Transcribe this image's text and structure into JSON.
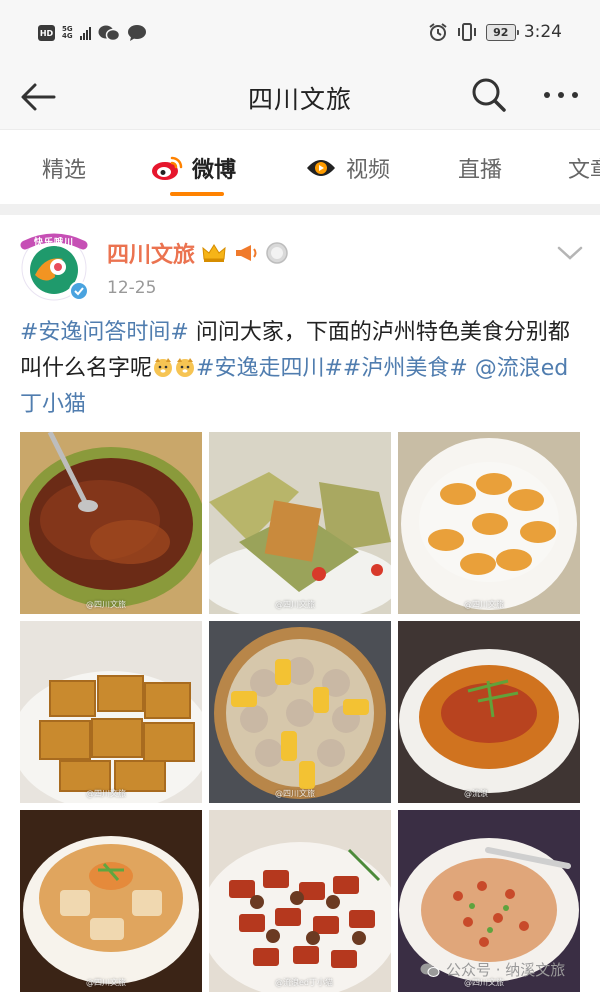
{
  "status_bar": {
    "hd_label": "HD",
    "network_top": "5G",
    "network_bottom": "4G",
    "battery": "92",
    "time": "3:24"
  },
  "header": {
    "title": "四川文旅"
  },
  "tabs": [
    {
      "label": "精选",
      "active": false
    },
    {
      "label": "微博",
      "active": true
    },
    {
      "label": "视频",
      "active": false
    },
    {
      "label": "直播",
      "active": false
    },
    {
      "label": "文章",
      "active": false
    }
  ],
  "post": {
    "avatar_text": "快乐哦川",
    "author": "四川文旅",
    "date": "12-25",
    "text_segments": [
      {
        "text": "#安逸问答时间#",
        "is_tag": true
      },
      {
        "text": " 问问大家，下面的泸州特色美食分别都叫什么名字呢",
        "is_tag": false
      },
      {
        "text": "#安逸走四川##泸州美食#",
        "is_tag": true
      },
      {
        "text": " ",
        "is_tag": false
      },
      {
        "text": "@流浪ed丁小猫",
        "is_tag": true
      }
    ],
    "images": [
      {
        "name": "spicy-crumble-bowl",
        "watermark": "@四川文旅"
      },
      {
        "name": "leaf-wrapped-cakes",
        "watermark": "@四川文旅"
      },
      {
        "name": "yellow-dumpling-plate",
        "watermark": "@四川文旅"
      },
      {
        "name": "fried-tofu-blocks",
        "watermark": "@四川文旅"
      },
      {
        "name": "corn-rice-steamer",
        "watermark": "@四川文旅"
      },
      {
        "name": "spicy-bean-dish",
        "watermark": "@流浪"
      },
      {
        "name": "tofu-soup-bowl",
        "watermark": "@四川文旅"
      },
      {
        "name": "chili-fried-meat",
        "watermark": "@流浪ed丁小猫"
      },
      {
        "name": "diced-stirfry-plate",
        "watermark": "@四川文旅"
      }
    ]
  },
  "overlay_watermark": "公众号 · 纳溪文旅",
  "colors": {
    "accent_orange": "#ff8200",
    "author_orange": "#eb7350",
    "link_blue": "#507daf"
  }
}
